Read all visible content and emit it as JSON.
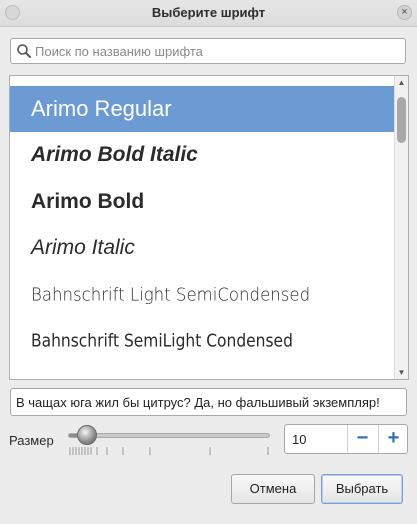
{
  "window": {
    "title": "Выберите шрифт",
    "close_glyph": "×"
  },
  "search": {
    "placeholder": "Поиск по названию шрифта",
    "value": ""
  },
  "font_list": {
    "items": [
      {
        "label": "Arimo Regular",
        "selected": true
      },
      {
        "label": "Arimo Bold Italic",
        "selected": false
      },
      {
        "label": "Arimo Bold",
        "selected": false
      },
      {
        "label": "Arimo Italic",
        "selected": false
      },
      {
        "label": "Bahnschrift Light SemiCondensed",
        "selected": false
      },
      {
        "label": "Bahnschrift SemiLight Condensed",
        "selected": false
      }
    ]
  },
  "preview": {
    "text": "В чащах юга жил бы цитрус? Да, но фальшивый экземпляр!"
  },
  "size": {
    "label": "Размер",
    "value": "10",
    "slider_fraction": 0.05
  },
  "buttons": {
    "cancel": "Отмена",
    "select": "Выбрать",
    "decrease": "−",
    "increase": "+"
  },
  "colors": {
    "selection": "#6b9bd2",
    "accent": "#2f6db5",
    "window_bg": "#ececec"
  },
  "icons": {
    "search": "search-icon",
    "close": "close-icon",
    "minus": "minus-icon",
    "plus": "plus-icon"
  }
}
